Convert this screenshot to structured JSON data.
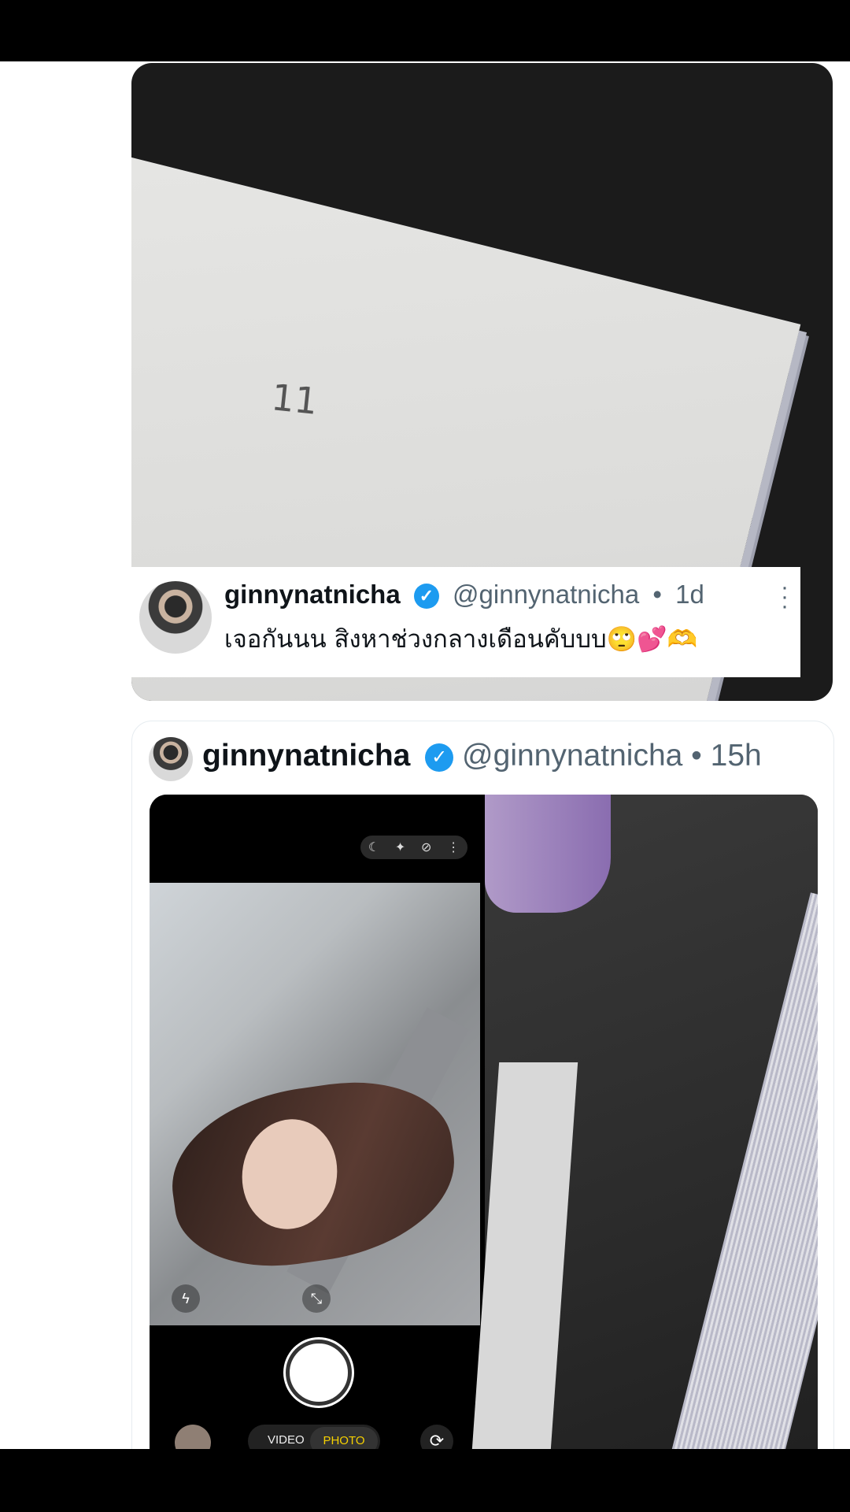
{
  "quoted_tweet": {
    "photo_text": "11",
    "display_name": "ginnynatnicha",
    "handle": "@ginnynatnicha",
    "time": "1d",
    "text": "เจอกันนน สิงหาช่วงกลางเดือนคับบบ",
    "emojis": "🙄💕🫶"
  },
  "tweet": {
    "display_name": "ginnynatnicha",
    "handle": "@ginnynatnicha",
    "time": "15h",
    "camera_ui": {
      "mode_video": "VIDEO",
      "mode_photo": "PHOTO"
    }
  },
  "icons": {
    "verified": "verified-badge-icon",
    "more": "more-options-icon"
  },
  "colors": {
    "verified": "#1d9bf0",
    "text": "#0f1419",
    "secondary": "#536471",
    "camera_mode_active": "#f5d000"
  }
}
